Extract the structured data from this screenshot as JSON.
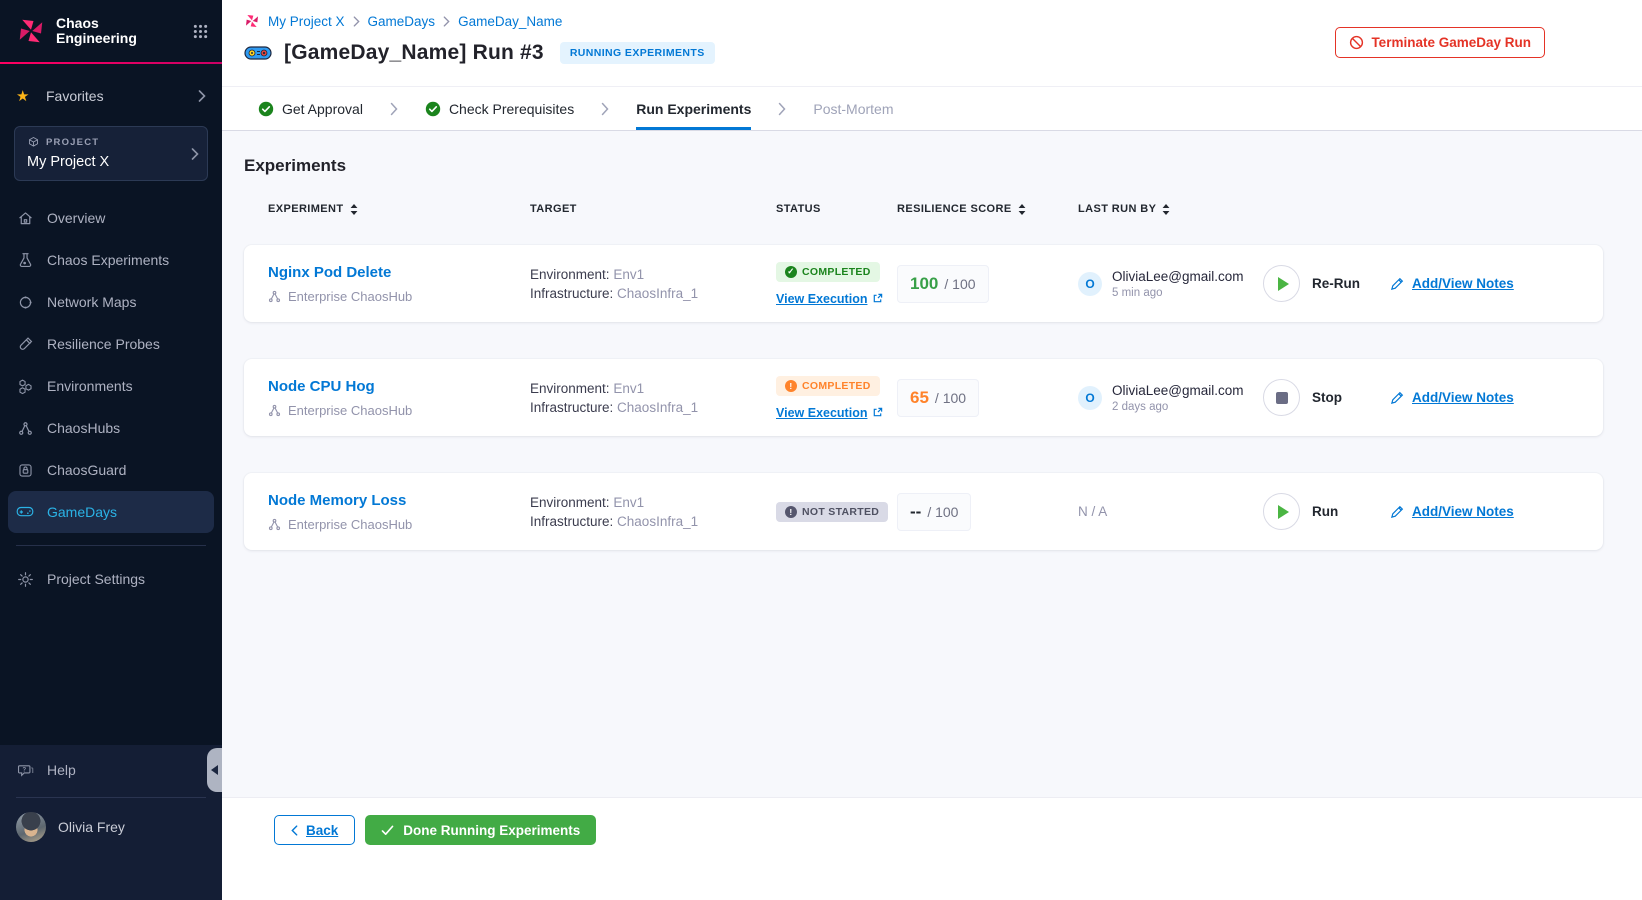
{
  "colors": {
    "accent_blue": "#0278d5",
    "brand_pink": "#ff0062",
    "success_green": "#1b841d",
    "action_green": "#42ab45",
    "warning_orange": "#ff832b",
    "danger_red": "#e43326",
    "sidebar_bg": "#0a1424",
    "active_nav_blue": "#2bb3e6",
    "content_bg": "#f7f8fc"
  },
  "icons": {
    "logo": "chaos-pinwheel",
    "grid": "nine-dots-app-grid",
    "star": "★",
    "project": "cube",
    "terminate": "circle-slash",
    "step_done": "check-circle",
    "separator": "chevron-right",
    "external": "external-link",
    "play": "play-triangle",
    "stop": "stop-square",
    "notes": "pencil",
    "sort": "up-down-arrows"
  },
  "sidebar": {
    "app_title": "Chaos Engineering",
    "favorites_label": "Favorites",
    "project_label": "PROJECT",
    "project_name": "My Project X",
    "items": [
      {
        "label": "Overview",
        "icon": "home-icon"
      },
      {
        "label": "Chaos Experiments",
        "icon": "flask-icon"
      },
      {
        "label": "Network Maps",
        "icon": "network-map-icon"
      },
      {
        "label": "Resilience Probes",
        "icon": "probe-icon"
      },
      {
        "label": "Environments",
        "icon": "hexagons-icon"
      },
      {
        "label": "ChaosHubs",
        "icon": "hub-icon"
      },
      {
        "label": "ChaosGuard",
        "icon": "lock-icon"
      },
      {
        "label": "GameDays",
        "icon": "gamepad-icon",
        "active": true
      }
    ],
    "settings_label": "Project Settings",
    "help_label": "Help",
    "user_name": "Olivia Frey"
  },
  "header": {
    "breadcrumb": [
      "My Project X",
      "GameDays",
      "GameDay_Name"
    ],
    "title": "[GameDay_Name] Run #3",
    "status_badge": "RUNNING EXPERIMENTS",
    "terminate_label": "Terminate GameDay Run"
  },
  "stepper": {
    "steps": [
      {
        "label": "Get Approval",
        "state": "done"
      },
      {
        "label": "Check Prerequisites",
        "state": "done"
      },
      {
        "label": "Run Experiments",
        "state": "active"
      },
      {
        "label": "Post-Mortem",
        "state": "upcoming"
      }
    ]
  },
  "main": {
    "heading": "Experiments",
    "columns": [
      "EXPERIMENT",
      "TARGET",
      "STATUS",
      "RESILIENCE SCORE",
      "LAST RUN BY"
    ],
    "rows": [
      {
        "name": "Nginx Pod Delete",
        "hub": "Enterprise ChaosHub",
        "env_label": "Environment:",
        "env_value": "Env1",
        "infra_label": "Infrastructure:",
        "infra_value": "ChaosInfra_1",
        "status": "COMPLETED",
        "status_kind": "success",
        "view_link": "View Execution",
        "score": "100",
        "score_suffix": "/ 100",
        "run_by_initial": "O",
        "run_by": "OliviaLee@gmail.com",
        "run_time": "5 min ago",
        "action": "Re-Run",
        "notes": "Add/View Notes"
      },
      {
        "name": "Node CPU Hog",
        "hub": "Enterprise ChaosHub",
        "env_label": "Environment:",
        "env_value": "Env1",
        "infra_label": "Infrastructure:",
        "infra_value": "ChaosInfra_1",
        "status": "COMPLETED",
        "status_kind": "warning",
        "view_link": "View Execution",
        "score": "65",
        "score_suffix": "/ 100",
        "run_by_initial": "O",
        "run_by": "OliviaLee@gmail.com",
        "run_time": "2 days ago",
        "action": "Stop",
        "notes": "Add/View Notes"
      },
      {
        "name": "Node Memory Loss",
        "hub": "Enterprise ChaosHub",
        "env_label": "Environment:",
        "env_value": "Env1",
        "infra_label": "Infrastructure:",
        "infra_value": "ChaosInfra_1",
        "status": "NOT STARTED",
        "status_kind": "neutral",
        "score": "--",
        "score_suffix": "/ 100",
        "run_by_na": "N / A",
        "action": "Run",
        "notes": "Add/View Notes"
      }
    ]
  },
  "footer": {
    "back_label": "Back",
    "done_label": "Done Running Experiments"
  }
}
